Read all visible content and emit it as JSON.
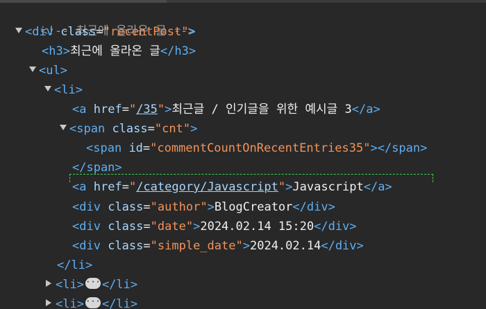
{
  "tree": {
    "comment": "<!-- 최근에 올라온 글 -->",
    "div_class_value": "recentPost",
    "h3_text": "최근에 올라온 글",
    "li1": {
      "a1_href": "/35",
      "a1_text": "최근글 / 인기글을 위한 예시글 3",
      "span_class_value": "cnt",
      "inner_span_id_value": "commentCountOnRecentEntries35",
      "a2_href": "/category/Javascript",
      "a2_text": "Javascript",
      "author_class_value": "author",
      "author_text": "BlogCreator",
      "date_class_value": "date",
      "date_text": "2024.02.14 15:20",
      "simple_date_class_value": "simple_date",
      "simple_date_text": "2024.02.14"
    },
    "collapsed_ellipsis": "···"
  }
}
